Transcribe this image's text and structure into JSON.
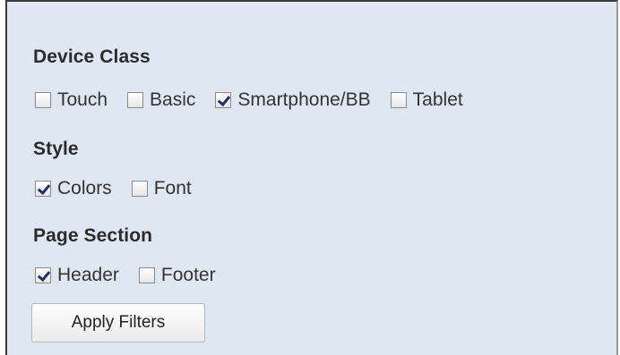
{
  "filters": {
    "device_class": {
      "title": "Device Class",
      "options": [
        {
          "label": "Touch",
          "checked": false
        },
        {
          "label": "Basic",
          "checked": false
        },
        {
          "label": "Smartphone/BB",
          "checked": true
        },
        {
          "label": "Tablet",
          "checked": false
        }
      ]
    },
    "style": {
      "title": "Style",
      "options": [
        {
          "label": "Colors",
          "checked": true
        },
        {
          "label": "Font",
          "checked": false
        }
      ]
    },
    "page_section": {
      "title": "Page Section",
      "options": [
        {
          "label": "Header",
          "checked": true
        },
        {
          "label": "Footer",
          "checked": false
        }
      ]
    }
  },
  "apply_button": {
    "label": "Apply Filters"
  },
  "icons": {
    "checkbox": "checkbox-icon"
  }
}
